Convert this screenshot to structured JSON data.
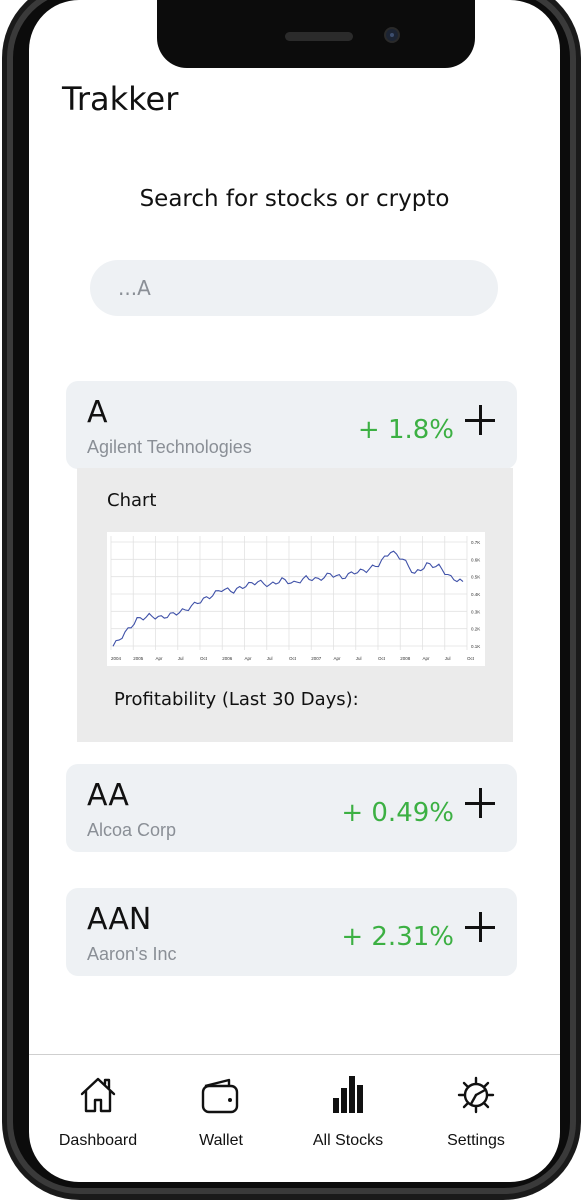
{
  "app": {
    "title": "Trakker"
  },
  "search": {
    "heading": "Search for stocks or crypto",
    "value": "...A"
  },
  "stocks": [
    {
      "ticker": "A",
      "name": "Agilent Technologies",
      "change": "+ 1.8%",
      "expanded": true
    },
    {
      "ticker": "AA",
      "name": "Alcoa Corp",
      "change": "+ 0.49%",
      "expanded": false
    },
    {
      "ticker": "AAN",
      "name": "Aaron's Inc",
      "change": "+ 2.31%",
      "expanded": false
    }
  ],
  "detail": {
    "chart_label": "Chart",
    "profit_label": "Profitability (Last 30 Days):"
  },
  "chart_data": {
    "type": "line",
    "x_ticks": [
      "2004",
      "2005",
      "Apr",
      "Jul",
      "Oct",
      "2006",
      "Apr",
      "Jul",
      "Oct",
      "2007",
      "Apr",
      "Jul",
      "Oct",
      "2008",
      "Apr",
      "Jul",
      "Oct"
    ],
    "y_ticks": [
      "0.7K",
      "0.6K",
      "0.5K",
      "0.4K",
      "0.3K",
      "0.2K",
      "0.1K"
    ],
    "series": [
      {
        "values": [
          0.12,
          0.19,
          0.26,
          0.28,
          0.27,
          0.29,
          0.31,
          0.35,
          0.38,
          0.42,
          0.41,
          0.44,
          0.46,
          0.44,
          0.47,
          0.45,
          0.48,
          0.47,
          0.5,
          0.48,
          0.51,
          0.52,
          0.55,
          0.62,
          0.58,
          0.5,
          0.55,
          0.54,
          0.48,
          0.46
        ]
      }
    ],
    "colors": {
      "line": "#3f51a8"
    }
  },
  "tabs": [
    {
      "label": "Dashboard",
      "icon": "home-icon"
    },
    {
      "label": "Wallet",
      "icon": "wallet-icon"
    },
    {
      "label": "All Stocks",
      "icon": "bar-chart-icon"
    },
    {
      "label": "Settings",
      "icon": "gear-icon"
    }
  ],
  "colors": {
    "positive": "#3cb043",
    "card_bg": "#eef1f4"
  }
}
